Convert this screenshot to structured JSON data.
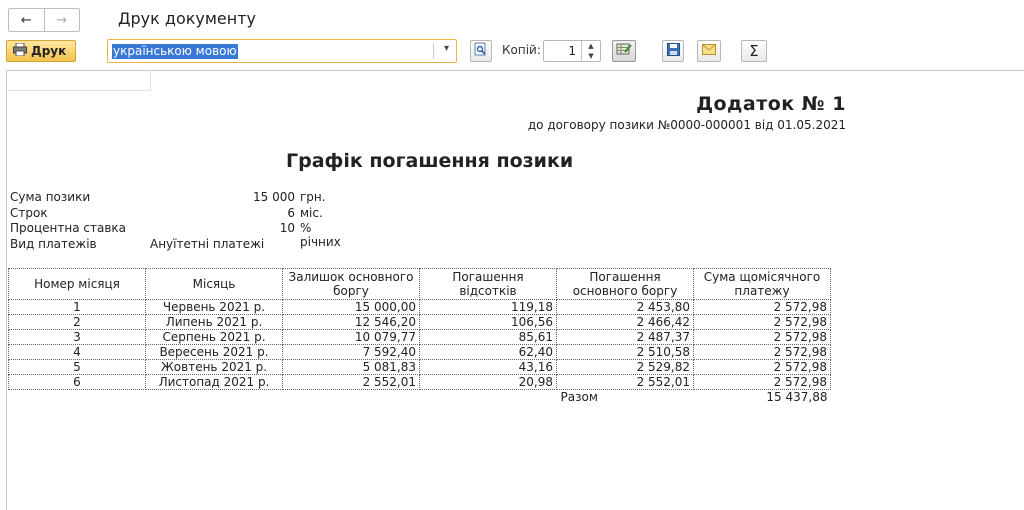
{
  "window": {
    "title": "Друк документу"
  },
  "nav": {
    "back_symbol": "←",
    "forward_symbol": "→"
  },
  "toolbar": {
    "print_label": "Друк",
    "language_value": "українською мовою",
    "copies_label": "Копій:",
    "copies_value": "1"
  },
  "report": {
    "addendum_title": "Додаток № 1",
    "contract_ref": "до договору позики №0000-000001 від 01.05.2021",
    "title": "Графік погашення позики",
    "info": [
      {
        "label": "Сума позики",
        "value": "15 000",
        "unit": "грн."
      },
      {
        "label": "Строк",
        "value": "6",
        "unit": "міс."
      },
      {
        "label": "Процентна ставка",
        "value": "10",
        "unit": "% річних"
      },
      {
        "label": "Вид платежів",
        "value": "Ануїтетні платежі",
        "unit": ""
      }
    ],
    "columns": [
      "Номер місяця",
      "Місяць",
      "Залишок основного боргу",
      "Погашення відсотків",
      "Погашення основного боргу",
      "Сума щомісячного платежу"
    ],
    "rows": [
      [
        "1",
        "Червень 2021 р.",
        "15 000,00",
        "119,18",
        "2 453,80",
        "2 572,98"
      ],
      [
        "2",
        "Липень 2021 р.",
        "12 546,20",
        "106,56",
        "2 466,42",
        "2 572,98"
      ],
      [
        "3",
        "Серпень 2021 р.",
        "10 079,77",
        "85,61",
        "2 487,37",
        "2 572,98"
      ],
      [
        "4",
        "Вересень 2021 р.",
        "7 592,40",
        "62,40",
        "2 510,58",
        "2 572,98"
      ],
      [
        "5",
        "Жовтень 2021 р.",
        "5 081,83",
        "43,16",
        "2 529,82",
        "2 572,98"
      ],
      [
        "6",
        "Листопад 2021 р.",
        "2 552,01",
        "20,98",
        "2 552,01",
        "2 572,98"
      ]
    ],
    "total_label": "Разом",
    "total_value": "15 437,88"
  }
}
